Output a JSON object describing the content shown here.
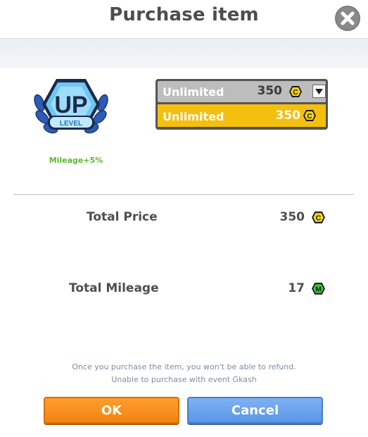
{
  "dialog": {
    "title": "Purchase item",
    "close_icon": "close-icon"
  },
  "item": {
    "badge_text": "UP",
    "badge_subtext": "LEVEL",
    "mileage_bonus": "Mileage+5%"
  },
  "duration_select": {
    "selected": {
      "label": "Unlimited",
      "price": "350"
    },
    "options": [
      {
        "label": "Unlimited",
        "price": "350"
      }
    ],
    "currency_icon": "c-coin-icon",
    "arrow_icon": "dropdown-arrow-icon"
  },
  "summary": {
    "total_price_label": "Total Price",
    "total_price_value": "350",
    "total_mileage_label": "Total Mileage",
    "total_mileage_value": "17"
  },
  "notice": {
    "line1": "Once you purchase the item, you won't be able to refund.",
    "line2": "Unable to purchase with event Gkash"
  },
  "buttons": {
    "ok": "OK",
    "cancel": "Cancel"
  },
  "colors": {
    "ok_orange": "#f28410",
    "cancel_blue": "#5a95e6",
    "selected_yellow": "#f4bf0d",
    "mileage_green": "#5cb832"
  }
}
